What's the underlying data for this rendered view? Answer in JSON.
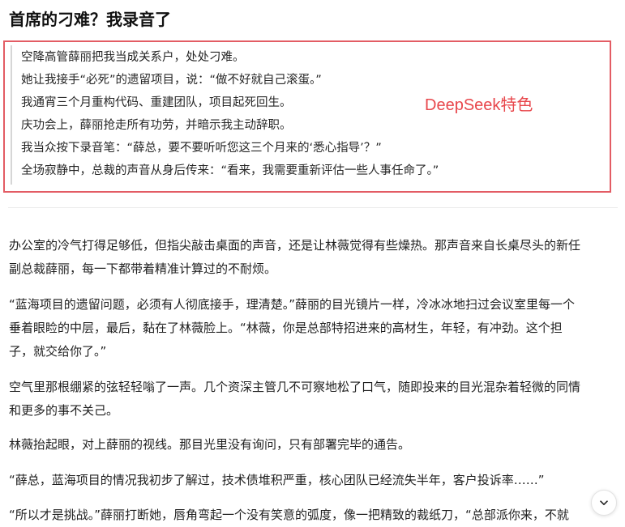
{
  "article": {
    "title": "首席的刁难？我录音了"
  },
  "highlight": {
    "lines": [
      "空降高管薛丽把我当成关系户，处处刁难。",
      "她让我接手“必死”的遗留项目，说：“做不好就自己滚蛋。”",
      "我通宵三个月重构代码、重建团队，项目起死回生。",
      "庆功会上，薛丽抢走所有功劳，并暗示我主动辞职。",
      "我当众按下录音笔：“薛总，要不要听听您这三个月来的‘悉心指导’？”",
      "全场寂静中，总裁的声音从身后传来：“看来，我需要重新评估一些人事任命了。”"
    ],
    "label": "DeepSeek特色",
    "border_color": "#e35c64",
    "label_color": "#e8474c"
  },
  "paragraphs": [
    {
      "lines": [
        "办公室的冷气打得足够低，但指尖敲击桌面的声音，还是让林薇觉得有些燥热。那声音来自长桌尽头的新任",
        "副总裁薛丽，每一下都带着精准计算过的不耐烦。"
      ]
    },
    {
      "lines": [
        "“蓝海项目的遗留问题，必须有人彻底接手，理清楚。”薛丽的目光镜片一样，冷冰冰地扫过会议室里每一个",
        "垂着眼睑的中层，最后，黏在了林薇脸上。“林薇，你是总部特招进来的高材生，年轻，有冲劲。这个担",
        "子，就交给你了。”"
      ]
    },
    {
      "lines": [
        "空气里那根绷紧的弦轻轻嗡了一声。几个资深主管几不可察地松了口气，随即投来的目光混杂着轻微的同情",
        "和更多的事不关己。"
      ]
    },
    {
      "lines": [
        "林薇抬起眼，对上薛丽的视线。那目光里没有询问，只有部署完毕的通告。"
      ]
    },
    {
      "lines": [
        "“薛总，蓝海项目的情况我初步了解过，技术债堆积严重，核心团队已经流失半年，客户投诉率……”"
      ]
    },
    {
      "lines": [
        "“所以才是挑战。”薛丽打断她，唇角弯起一个没有笑意的弧度，像一把精致的裁纸刀，“总部派你来，不就"
      ]
    }
  ],
  "controls": {
    "scroll_down_icon": "chevron-down-icon"
  }
}
